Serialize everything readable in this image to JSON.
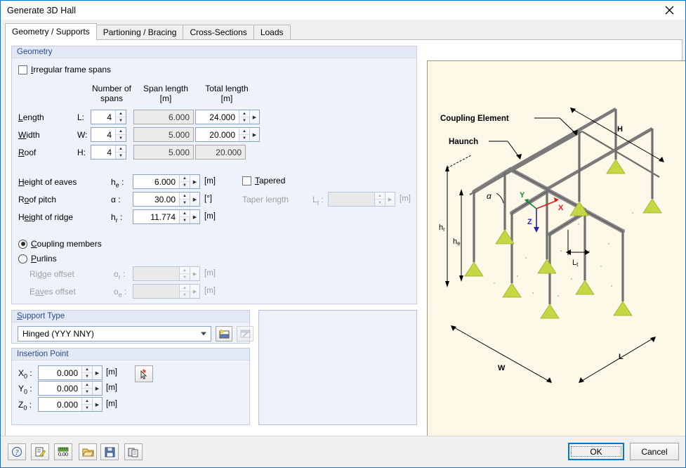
{
  "window": {
    "title": "Generate 3D Hall",
    "close_icon": "close-icon"
  },
  "tabs": [
    {
      "label": "Geometry / Supports",
      "active": true
    },
    {
      "label": "Partioning / Bracing",
      "active": false
    },
    {
      "label": "Cross-Sections",
      "active": false
    },
    {
      "label": "Loads",
      "active": false
    }
  ],
  "geometry": {
    "title": "Geometry",
    "irregular_checkbox": {
      "label": "Irregular frame spans",
      "checked": false
    },
    "columns": {
      "number_of_spans": "Number of\nspans",
      "number_of_spans_line1": "Number of",
      "number_of_spans_line2": "spans",
      "span_length_line1": "Span length",
      "span_length_line2": "[m]",
      "total_length_line1": "Total length",
      "total_length_line2": "[m]"
    },
    "rows": [
      {
        "label": "Length",
        "accel": "L",
        "symbol": "L",
        "spans": "4",
        "span_length": "6.000",
        "total_length": "24.000",
        "total_editable": true
      },
      {
        "label": "Width",
        "accel": "W",
        "symbol": "W",
        "spans": "4",
        "span_length": "5.000",
        "total_length": "20.000",
        "total_editable": true
      },
      {
        "label": "Roof",
        "accel": "R",
        "symbol": "H",
        "spans": "4",
        "span_length": "5.000",
        "total_length": "20.000",
        "total_editable": false
      }
    ],
    "height_of_eaves": {
      "label": "Height of eaves",
      "symbol": "h",
      "sub": "e",
      "value": "6.000",
      "unit": "[m]"
    },
    "roof_pitch": {
      "label": "Roof pitch",
      "symbol": "α",
      "sub": "",
      "value": "30.00",
      "unit": "[°]"
    },
    "height_of_ridge": {
      "label": "Height of ridge",
      "symbol": "h",
      "sub": "r",
      "value": "11.774",
      "unit": "[m]"
    },
    "tapered": {
      "label": "Tapered",
      "checked": false
    },
    "taper_length": {
      "label": "Taper length",
      "symbol": "L",
      "sub": "t",
      "value": "",
      "unit": "[m]",
      "enabled": false
    },
    "member_type": {
      "coupling": {
        "label": "Coupling members",
        "selected": true
      },
      "purlins": {
        "label": "Purlins",
        "selected": false
      }
    },
    "ridge_offset": {
      "label": "Ridge offset",
      "symbol": "o",
      "sub": "r",
      "value": "",
      "unit": "[m]",
      "enabled": false
    },
    "eaves_offset": {
      "label": "Eaves offset",
      "symbol": "o",
      "sub": "e",
      "value": "",
      "unit": "[m]",
      "enabled": false
    }
  },
  "support_type": {
    "title": "Support Type",
    "selected": "Hinged (YYY NNY)",
    "new_button_icon": "new-support-icon",
    "edit_button_icon": "edit-support-icon"
  },
  "insertion_point": {
    "title": "Insertion Point",
    "pick_button_icon": "pick-point-icon",
    "fields": [
      {
        "symbol": "X",
        "sub": "0",
        "value": "0.000",
        "unit": "[m]"
      },
      {
        "symbol": "Y",
        "sub": "0",
        "value": "0.000",
        "unit": "[m]"
      },
      {
        "symbol": "Z",
        "sub": "0",
        "value": "0.000",
        "unit": "[m]"
      }
    ]
  },
  "preview": {
    "labels": {
      "coupling_element": "Coupling Element",
      "haunch": "Haunch",
      "height_ridge": "h",
      "height_ridge_sub": "r",
      "height_eaves": "h",
      "height_eaves_sub": "e",
      "alpha": "α",
      "roof_dim": "H",
      "taper_dim": "L",
      "taper_dim_sub": "t",
      "width_dim": "W",
      "length_dim": "L",
      "axis_x": "X",
      "axis_y": "Y",
      "axis_z": "Z"
    },
    "colors": {
      "background": "#fdf8e8",
      "member": "#808080",
      "support": "#c4d843",
      "axis_x": "#e01b1b",
      "axis_y": "#0e8a2e",
      "axis_z": "#2727b5"
    }
  },
  "toolbar": [
    {
      "icon": "help-icon",
      "name": "help-button"
    },
    {
      "icon": "edit-icon",
      "name": "edit-button"
    },
    {
      "icon": "units-icon",
      "name": "units-button"
    },
    {
      "icon": "open-folder-icon",
      "name": "open-button"
    },
    {
      "icon": "save-icon",
      "name": "save-button"
    },
    {
      "icon": "clipboard-icon",
      "name": "clipboard-button"
    }
  ],
  "footer": {
    "ok_label": "OK",
    "cancel_label": "Cancel"
  }
}
